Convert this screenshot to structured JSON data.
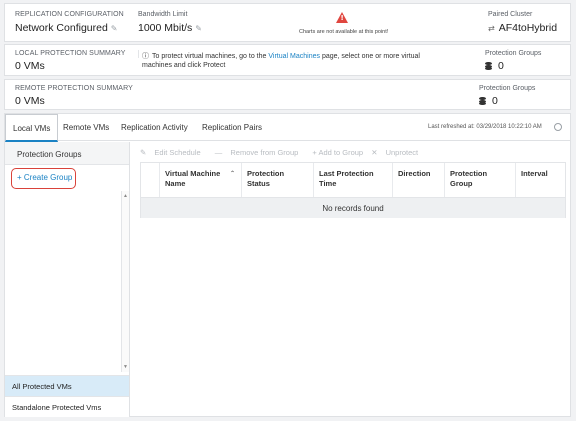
{
  "replication": {
    "config_label": "REPLICATION CONFIGURATION",
    "config_value": "Network Configured",
    "bandwidth_label": "Bandwidth Limit",
    "bandwidth_value": "1000 Mbit/s",
    "charts_message": "Charts are not available at this point!",
    "paired_label": "Paired Cluster",
    "paired_value": "AF4toHybrid"
  },
  "local_summary": {
    "label": "LOCAL PROTECTION SUMMARY",
    "value": "0 VMs",
    "info_prefix": "To protect virtual machines, go to the",
    "info_link": "Virtual Machines",
    "info_suffix": "page, select one or more virtual",
    "info_line2": "machines and click Protect",
    "groups_label": "Protection Groups",
    "groups_value": "0"
  },
  "remote_summary": {
    "label": "REMOTE PROTECTION SUMMARY",
    "value": "0 VMs",
    "groups_label": "Protection Groups",
    "groups_value": "0"
  },
  "tabs": [
    {
      "label": "Local VMs",
      "active": true
    },
    {
      "label": "Remote VMs"
    },
    {
      "label": "Replication Activity"
    },
    {
      "label": "Replication Pairs"
    }
  ],
  "last_refreshed": "Last refreshed at: 03/29/2018 10:22:10 AM",
  "sidebar": {
    "header": "Protection Groups",
    "create_label": "+ Create Group",
    "items": [
      {
        "label": "All Protected VMs",
        "selected": true
      },
      {
        "label": "Standalone Protected Vms"
      }
    ]
  },
  "toolbar": {
    "edit": "Edit Schedule",
    "remove": "Remove from Group",
    "add": "+ Add to Group",
    "unprotect": "Unprotect"
  },
  "table": {
    "columns": [
      "Virtual Machine Name",
      "Protection Status",
      "Last Protection Time",
      "Direction",
      "Protection Group",
      "Interval"
    ],
    "empty_message": "No records found"
  }
}
